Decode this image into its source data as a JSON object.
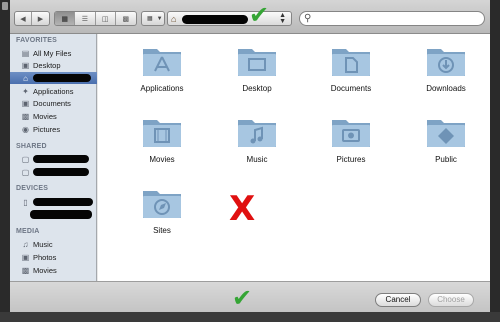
{
  "toolbar": {
    "back_icon": "back-arrow-icon",
    "forward_icon": "forward-arrow-icon",
    "view_modes": [
      "icon-view",
      "list-view",
      "column-view",
      "coverflow-view"
    ],
    "arrange_icon": "arrange-grid-icon",
    "path_icon": "home-icon",
    "search_placeholder": ""
  },
  "annotation": {
    "check_color": "#35a535",
    "x_color": "#e01010",
    "x_text": "X"
  },
  "sidebar": {
    "favorites_header": "FAVORITES",
    "favorites": [
      {
        "label": "All My Files",
        "icon": "all-files-icon"
      },
      {
        "label": "Desktop",
        "icon": "desktop-icon"
      },
      {
        "label": "",
        "icon": "home-icon"
      },
      {
        "label": "Applications",
        "icon": "applications-icon"
      },
      {
        "label": "Documents",
        "icon": "documents-icon"
      },
      {
        "label": "Movies",
        "icon": "movies-icon"
      },
      {
        "label": "Pictures",
        "icon": "pictures-icon"
      }
    ],
    "shared_header": "SHARED",
    "devices_header": "DEVICES",
    "media_header": "MEDIA",
    "media": [
      {
        "label": "Music",
        "icon": "music-icon"
      },
      {
        "label": "Photos",
        "icon": "photos-icon"
      },
      {
        "label": "Movies",
        "icon": "movies-icon"
      }
    ]
  },
  "folders": [
    {
      "name": "Applications",
      "icon": "applications-folder-icon"
    },
    {
      "name": "Desktop",
      "icon": "desktop-folder-icon"
    },
    {
      "name": "Documents",
      "icon": "documents-folder-icon"
    },
    {
      "name": "Downloads",
      "icon": "downloads-folder-icon"
    },
    {
      "name": "Movies",
      "icon": "movies-folder-icon"
    },
    {
      "name": "Music",
      "icon": "music-folder-icon"
    },
    {
      "name": "Pictures",
      "icon": "pictures-folder-icon"
    },
    {
      "name": "Public",
      "icon": "public-folder-icon"
    },
    {
      "name": "Sites",
      "icon": "sites-folder-icon"
    }
  ],
  "buttons": {
    "cancel": "Cancel",
    "choose": "Choose"
  }
}
